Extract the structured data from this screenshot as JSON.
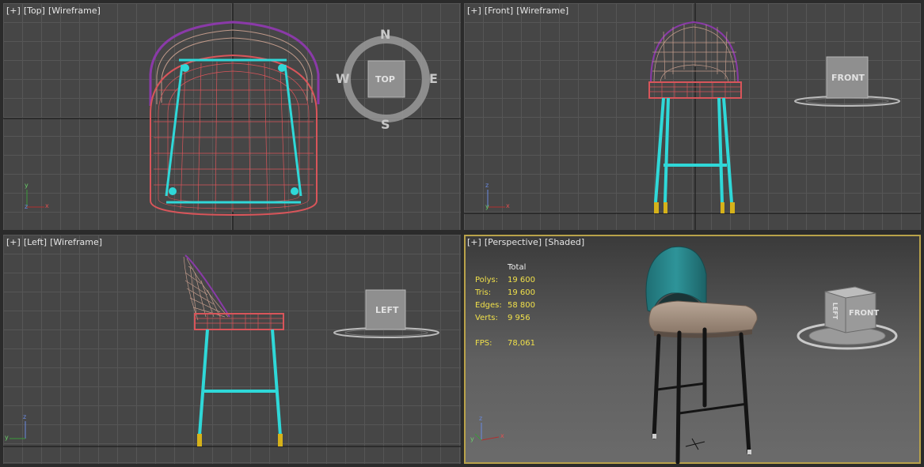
{
  "viewports": {
    "top": {
      "labels": [
        "[+]",
        "[Top]",
        "[Wireframe]"
      ],
      "compass": {
        "n": "N",
        "s": "S",
        "e": "E",
        "w": "W",
        "cube": "TOP"
      }
    },
    "front": {
      "labels": [
        "[+]",
        "[Front]",
        "[Wireframe]"
      ],
      "cube": "FRONT"
    },
    "left": {
      "labels": [
        "[+]",
        "[Left]",
        "[Wireframe]"
      ],
      "cube": "LEFT"
    },
    "perspective": {
      "labels": [
        "[+]",
        "[Perspective]",
        "[Shaded]"
      ],
      "cube_front": "FRONT",
      "cube_left": "LEFT",
      "stats": {
        "total_header": "Total",
        "polys_label": "Polys:",
        "polys": "19 600",
        "tris_label": "Tris:",
        "tris": "19 600",
        "edges_label": "Edges:",
        "edges": "58 800",
        "verts_label": "Verts:",
        "verts": "9 956",
        "fps_label": "FPS:",
        "fps": "78,061"
      }
    }
  },
  "axes": {
    "x": "x",
    "y": "y",
    "z": "z"
  },
  "colors": {
    "background": "#2b2b2b",
    "grid_bg": "#464646",
    "grid_line": "#565656",
    "active_border": "#b9a24a",
    "frame_wire": "#2fd8d8",
    "seat_wire": "#d8555a",
    "back_wire": "#c09a8a",
    "back_edge": "#8a3aa8",
    "foot_tip": "#d6b21a",
    "stats_text": "#f0e04a",
    "upholstery_teal": "#2a8a8e",
    "seat_fabric": "#a89484"
  }
}
